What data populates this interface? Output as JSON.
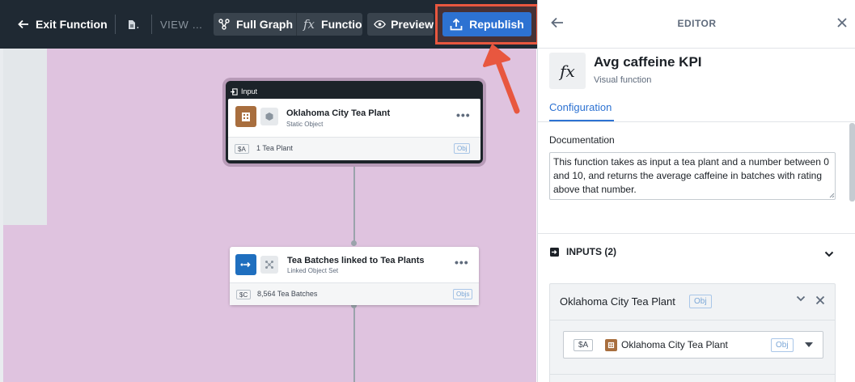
{
  "toolbar": {
    "exit_label": "Exit Function",
    "doc_label": "․",
    "view_label": "VIEW …",
    "full_graph_label": "Full Graph",
    "function_label": "Functio",
    "preview_label": "Preview",
    "republish_label": "Republish"
  },
  "graph": {
    "input_node": {
      "header": "Input",
      "title": "Oklahoma City Tea Plant",
      "subtitle": "Static Object",
      "var": "$A",
      "footer": "1 Tea Plant",
      "tag": "Obj"
    },
    "linked_node": {
      "title": "Tea Batches linked to Tea Plants",
      "subtitle": "Linked Object Set",
      "var": "$C",
      "footer": "8,564 Tea Batches",
      "tag": "Objs"
    }
  },
  "editor": {
    "title": "EDITOR",
    "function_name": "Avg caffeine KPI",
    "function_kind": "Visual function",
    "tab": "Configuration",
    "doc_label": "Documentation",
    "doc_text": "This function takes as input a tea plant and a number between 0 and 10, and returns the average caffeine in batches with rating above that number.",
    "inputs_header": "INPUTS (2)",
    "input": {
      "name": "Oklahoma City Tea Plant",
      "tag": "Obj",
      "var": "$A",
      "value": "Oklahoma City Tea Plant",
      "value_tag": "Obj"
    }
  },
  "colors": {
    "toolbar_bg": "#1f2933",
    "accent_blue": "#2d72d2",
    "highlight_red": "#e8573f",
    "canvas_bg": "#dfc3df",
    "object_brown": "#a86e3e",
    "linked_blue": "#1f6fbf"
  }
}
